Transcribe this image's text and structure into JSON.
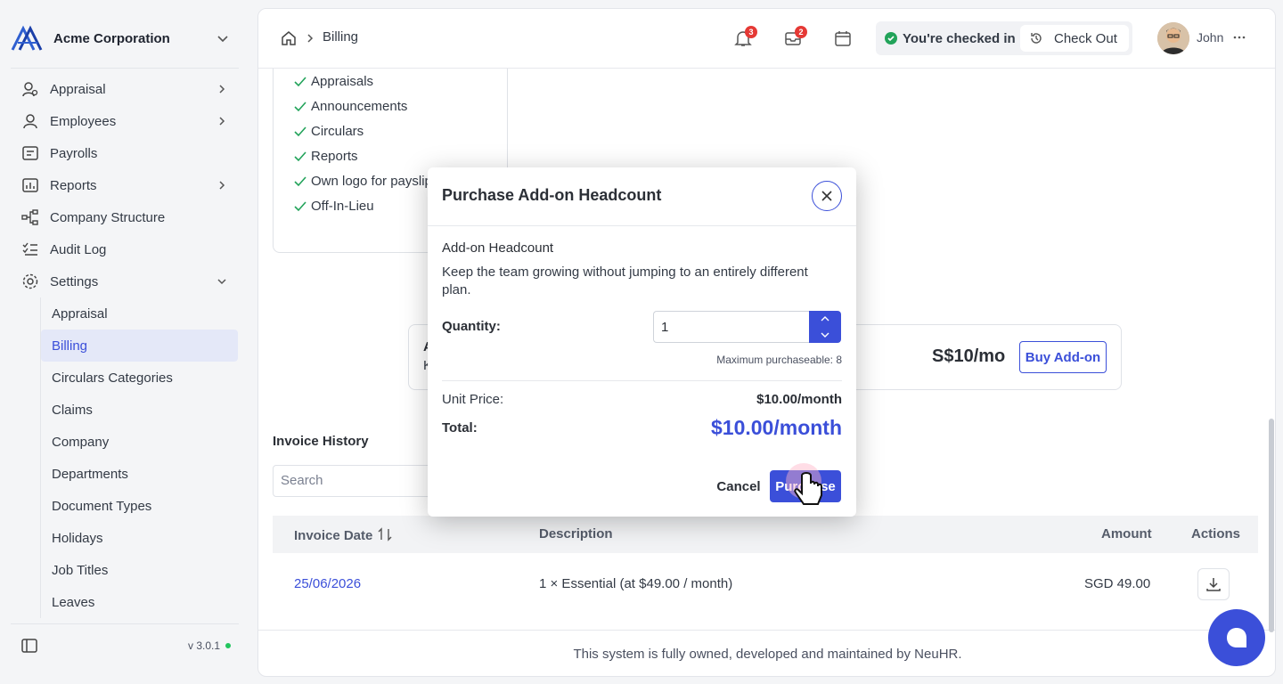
{
  "brand": {
    "name": "Acme Corporation",
    "logo_icon": "acme-logo"
  },
  "sidebar": {
    "items": [
      {
        "label": "Appraisal",
        "icon": "user-search-icon",
        "expandable": true
      },
      {
        "label": "Employees",
        "icon": "user-icon",
        "expandable": true
      },
      {
        "label": "Payrolls",
        "icon": "payroll-icon",
        "expandable": false
      },
      {
        "label": "Reports",
        "icon": "reports-icon",
        "expandable": true
      },
      {
        "label": "Company Structure",
        "icon": "org-structure-icon",
        "expandable": false
      },
      {
        "label": "Audit Log",
        "icon": "list-check-icon",
        "expandable": false
      },
      {
        "label": "Settings",
        "icon": "gear-icon",
        "expandable": true,
        "expanded": true
      }
    ],
    "settings_sub": [
      "Appraisal",
      "Billing",
      "Circulars Categories",
      "Claims",
      "Company",
      "Departments",
      "Document Types",
      "Holidays",
      "Job Titles",
      "Leaves"
    ],
    "active_sub": "Billing",
    "version": "v 3.0.1"
  },
  "header": {
    "breadcrumb": "Billing",
    "notifications_count": "3",
    "inbox_count": "2",
    "status": "You're checked in",
    "checkout_label": "Check Out",
    "user_name": "John"
  },
  "features": [
    "Appraisals",
    "Announcements",
    "Circulars",
    "Reports",
    "Own logo for payslip",
    "Off-In-Lieu"
  ],
  "addon_card": {
    "title_visible": "A",
    "desc_visible": "K",
    "price": "S$10/mo",
    "buy_label": "Buy Add-on"
  },
  "invoice": {
    "title": "Invoice History",
    "search_placeholder": "Search",
    "columns": [
      "Invoice Date",
      "Description",
      "Amount",
      "Actions"
    ],
    "rows": [
      {
        "date": "25/06/2026",
        "description": "1 × Essential (at $49.00 / month)",
        "amount": "SGD 49.00"
      }
    ]
  },
  "footer": "This system is fully owned, developed and maintained by NeuHR.",
  "modal": {
    "title": "Purchase Add-on Headcount",
    "name": "Add-on Headcount",
    "description": "Keep the team growing without jumping to an entirely different plan.",
    "quantity_label": "Quantity:",
    "quantity_value": "1",
    "max_text": "Maximum purchaseable: 8",
    "unit_price_label": "Unit Price:",
    "unit_price_value": "$10.00/month",
    "total_label": "Total:",
    "total_value": "$10.00/month",
    "cancel_label": "Cancel",
    "purchase_label": "Purchase"
  },
  "colors": {
    "accent": "#3b4fd9",
    "success": "#22a35a",
    "badge": "#e53935"
  }
}
